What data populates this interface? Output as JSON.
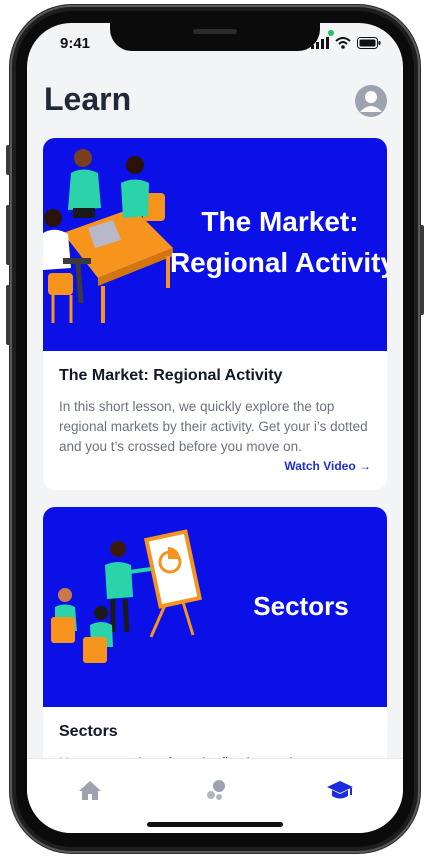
{
  "status_bar": {
    "time": "9:41"
  },
  "header": {
    "title": "Learn"
  },
  "cards": [
    {
      "hero_text_line1": "The  Market:",
      "hero_text_line2": "Regional Activity",
      "title": "The Market: Regional Activity",
      "description": "In this short lesson, we quickly explore the top regional markets by their activity. Get your i’s dotted and you t’s crossed before you move on.",
      "link": "Watch Video →"
    },
    {
      "hero_text": "Sectors",
      "title": "Sectors",
      "description": "Here we continue from the first lesson in"
    }
  ],
  "tabs": [
    {
      "icon": "home-icon"
    },
    {
      "icon": "bubbles-icon"
    },
    {
      "icon": "graduation-cap-icon",
      "active": true
    }
  ],
  "colors": {
    "accent": "#1d2ddb",
    "hero_bg": "#0a10e6",
    "illustration": "#f7941d",
    "figure_shirt": "#2bd4a8"
  }
}
